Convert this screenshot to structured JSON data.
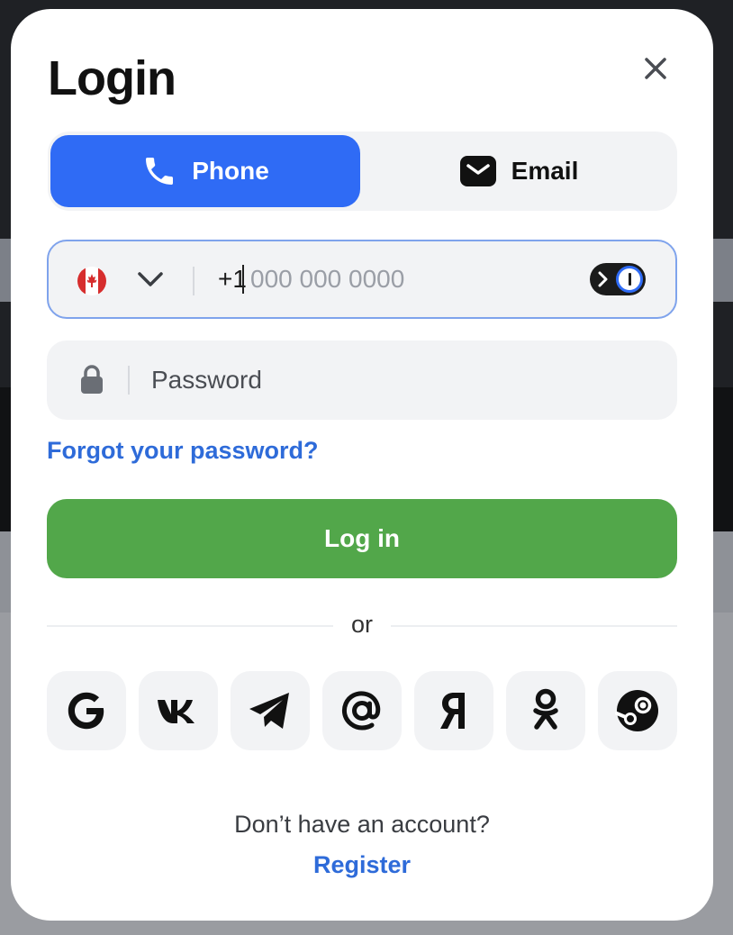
{
  "modal": {
    "title": "Login",
    "close_icon": "close-icon"
  },
  "tabs": [
    {
      "label": "Phone",
      "icon": "phone-icon",
      "active": true
    },
    {
      "label": "Email",
      "icon": "envelope-icon",
      "active": false
    }
  ],
  "phone_field": {
    "country_flag": "canada-flag-icon",
    "country_dropdown_icon": "chevron-down-icon",
    "prefix": "+1",
    "value": "",
    "placeholder": "000 000 0000",
    "password_manager_icon": "password-manager-icon"
  },
  "password_field": {
    "icon": "lock-icon",
    "value": "",
    "placeholder": "Password"
  },
  "forgot_password": "Forgot your password?",
  "login_button": "Log in",
  "separator_text": "or",
  "social_logins": [
    {
      "name": "Google",
      "icon": "google-icon"
    },
    {
      "name": "VK",
      "icon": "vk-icon"
    },
    {
      "name": "Telegram",
      "icon": "telegram-icon"
    },
    {
      "name": "Mail.ru",
      "icon": "at-sign-icon"
    },
    {
      "name": "Yandex",
      "icon": "yandex-icon"
    },
    {
      "name": "Odnoklassniki",
      "icon": "odnoklassniki-icon"
    },
    {
      "name": "Steam",
      "icon": "steam-icon"
    }
  ],
  "footer": {
    "prompt": "Don’t have an account?",
    "register_link": "Register"
  },
  "colors": {
    "primary_blue": "#2f6bf5",
    "link_blue": "#2e6bd9",
    "login_green": "#52a74a",
    "field_bg": "#f2f3f5"
  }
}
